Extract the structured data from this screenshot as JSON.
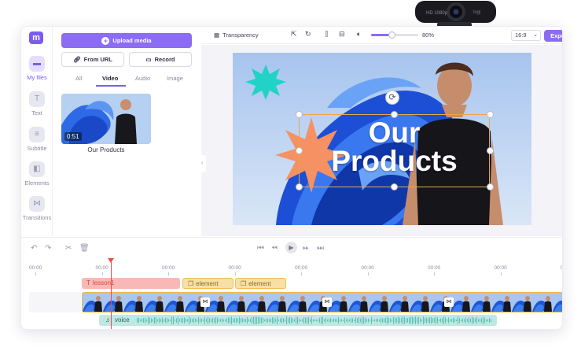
{
  "rail": {
    "items": [
      {
        "label": "My files",
        "icon": "folder-icon",
        "active": true
      },
      {
        "label": "Text",
        "icon": "text-icon",
        "active": false
      },
      {
        "label": "Subtitle",
        "icon": "subtitle-icon",
        "active": false
      },
      {
        "label": "Elements",
        "icon": "elements-icon",
        "active": false
      },
      {
        "label": "Transitions",
        "icon": "transitions-icon",
        "active": false
      }
    ]
  },
  "panel": {
    "upload_label": "Upload media",
    "from_url_label": "From URL",
    "record_label": "Record",
    "tabs": [
      "All",
      "Video",
      "Audio",
      "Image"
    ],
    "active_tab": "Video",
    "media": [
      {
        "name": "Our Products",
        "duration": "0:51"
      }
    ]
  },
  "toolbar": {
    "transparency_label": "Transparency",
    "volume": "80%",
    "volume_level": 0.8,
    "aspect_ratio": "16:9",
    "export_label": "Export"
  },
  "canvas": {
    "title_line1": "Our",
    "title_line2": "Products"
  },
  "timeline": {
    "ticks": [
      "00:00",
      "00:00",
      "00:00",
      "00:00",
      "00:00",
      "00:00",
      "00:00",
      "00:00",
      "00:00"
    ],
    "text_track_label": "lesson1",
    "element_labels": [
      "element",
      "element"
    ],
    "voice_label": "voice"
  },
  "colors": {
    "accent": "#8b6cf2",
    "track_border": "#f0b746",
    "text_chip": "#f8b9b6",
    "element_chip": "#f8dfa6",
    "voice": "#bfe8e2",
    "playhead": "#f04a4a"
  }
}
